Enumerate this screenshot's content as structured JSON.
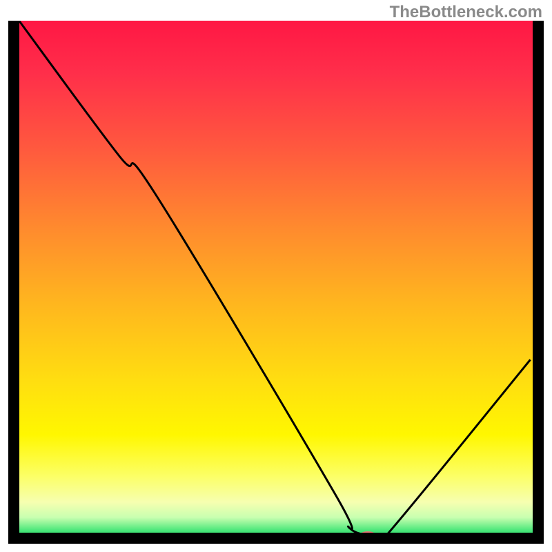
{
  "watermark": "TheBottleneck.com",
  "chart_data": {
    "type": "line",
    "title": "",
    "xlabel": "",
    "ylabel": "",
    "xlim": [
      0,
      100
    ],
    "ylim": [
      0,
      100
    ],
    "background_gradient": {
      "stops": [
        {
          "offset": 0.0,
          "color": "#ff1744"
        },
        {
          "offset": 0.1,
          "color": "#ff2e4a"
        },
        {
          "offset": 0.25,
          "color": "#ff5a3e"
        },
        {
          "offset": 0.4,
          "color": "#ff8a2e"
        },
        {
          "offset": 0.55,
          "color": "#ffb71e"
        },
        {
          "offset": 0.7,
          "color": "#ffdf10"
        },
        {
          "offset": 0.8,
          "color": "#fff700"
        },
        {
          "offset": 0.88,
          "color": "#fcff66"
        },
        {
          "offset": 0.93,
          "color": "#f6ffb0"
        },
        {
          "offset": 0.96,
          "color": "#c8ffb0"
        },
        {
          "offset": 0.985,
          "color": "#4ae77a"
        },
        {
          "offset": 1.0,
          "color": "#1dd267"
        }
      ]
    },
    "series": [
      {
        "name": "bottleneck-curve",
        "color": "#000000",
        "x": [
          1.0,
          20.0,
          27.0,
          61.0,
          64.0,
          69.0,
          71.0,
          98.5
        ],
        "y": [
          100.0,
          74.0,
          66.5,
          9.0,
          2.0,
          0.5,
          0.5,
          34.5
        ]
      }
    ],
    "marker": {
      "name": "optimal-point",
      "x": 67.5,
      "y": 0.8,
      "color": "#e57373",
      "rx": 10,
      "ry": 4
    },
    "frame": {
      "left": 12,
      "right": 12,
      "bottom": 12,
      "color": "#000000",
      "width_left_bottom": 16,
      "width_right": 16
    }
  }
}
